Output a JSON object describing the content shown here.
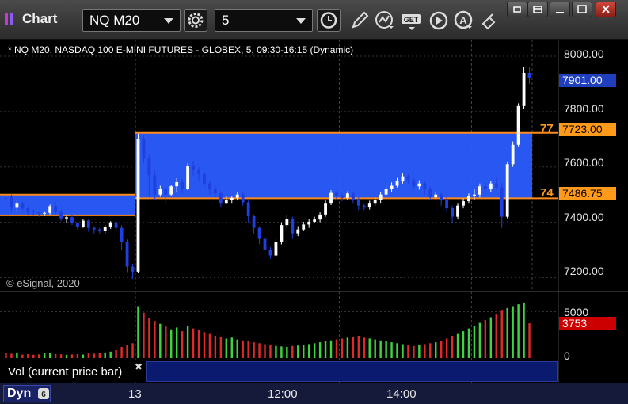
{
  "window": {
    "title": "Chart",
    "symbol": "NQ M20",
    "interval": "5"
  },
  "chart": {
    "header": "* NQ M20, NASDAQ 100 E-MINI FUTURES - GLOBEX, 5, 09:30-16:15 (Dynamic)",
    "copyright": "© eSignal, 2020",
    "y_axis_labels": [
      "8000.00",
      "7800.00",
      "7600.00",
      "7400.00",
      "7200.00"
    ],
    "current_price": "7901.00",
    "level_high": "7723.00",
    "level_low": "7486.75",
    "level_high_tag": "77",
    "level_low_tag": "74",
    "colors": {
      "zone": "#2a5cff",
      "level_line": "#ff8c1a",
      "current_flag": "#1f3fbf",
      "level_flag": "#ff9a1a",
      "vol_flag": "#cc0000",
      "up_candle": "#ffffff",
      "down_candle": "#1f3fe0",
      "vol_up": "#3fd43f",
      "vol_down": "#e02a2a"
    }
  },
  "volume": {
    "label": "Vol (current price bar)",
    "y_axis_labels": [
      "5000",
      "0"
    ],
    "current_value": "3753"
  },
  "bottom": {
    "mode": "Dyn",
    "time_labels": [
      "13",
      "12:00",
      "14:00"
    ]
  },
  "chart_data": {
    "type": "candlestick",
    "title": "* NQ M20, NASDAQ 100 E-MINI FUTURES - GLOBEX, 5, 09:30-16:15 (Dynamic)",
    "ylim": [
      7150,
      8060
    ],
    "zones": [
      {
        "x_from": 0,
        "x_to": 23,
        "high": 7500,
        "low": 7425
      },
      {
        "x_from": 24,
        "x_to": 95,
        "high": 7723,
        "low": 7486.75
      }
    ],
    "candles": [
      [
        7488,
        7485,
        7480,
        7492
      ],
      [
        7492,
        7455,
        7440,
        7500
      ],
      [
        7455,
        7470,
        7440,
        7478
      ],
      [
        7470,
        7450,
        7444,
        7474
      ],
      [
        7450,
        7440,
        7428,
        7456
      ],
      [
        7440,
        7436,
        7424,
        7446
      ],
      [
        7436,
        7432,
        7420,
        7440
      ],
      [
        7432,
        7434,
        7422,
        7440
      ],
      [
        7434,
        7458,
        7428,
        7464
      ],
      [
        7458,
        7440,
        7430,
        7472
      ],
      [
        7440,
        7414,
        7404,
        7446
      ],
      [
        7414,
        7418,
        7398,
        7424
      ],
      [
        7418,
        7396,
        7390,
        7426
      ],
      [
        7396,
        7384,
        7374,
        7400
      ],
      [
        7384,
        7406,
        7380,
        7412
      ],
      [
        7406,
        7380,
        7366,
        7410
      ],
      [
        7380,
        7374,
        7360,
        7386
      ],
      [
        7374,
        7368,
        7360,
        7380
      ],
      [
        7368,
        7384,
        7360,
        7390
      ],
      [
        7384,
        7400,
        7376,
        7404
      ],
      [
        7400,
        7380,
        7370,
        7410
      ],
      [
        7380,
        7330,
        7300,
        7390
      ],
      [
        7330,
        7240,
        7220,
        7338
      ],
      [
        7240,
        7222,
        7196,
        7250
      ],
      [
        7222,
        7702,
        7216,
        7720
      ],
      [
        7702,
        7630,
        7614,
        7712
      ],
      [
        7630,
        7570,
        7490,
        7642
      ],
      [
        7570,
        7500,
        7480,
        7590
      ],
      [
        7500,
        7520,
        7492,
        7532
      ],
      [
        7520,
        7500,
        7470,
        7526
      ],
      [
        7500,
        7530,
        7494,
        7536
      ],
      [
        7530,
        7545,
        7510,
        7560
      ],
      [
        7545,
        7520,
        7504,
        7556
      ],
      [
        7520,
        7602,
        7516,
        7614
      ],
      [
        7602,
        7590,
        7570,
        7622
      ],
      [
        7590,
        7574,
        7548,
        7600
      ],
      [
        7574,
        7540,
        7520,
        7580
      ],
      [
        7540,
        7522,
        7500,
        7546
      ],
      [
        7522,
        7504,
        7490,
        7530
      ],
      [
        7504,
        7470,
        7456,
        7512
      ],
      [
        7470,
        7480,
        7466,
        7496
      ],
      [
        7480,
        7488,
        7470,
        7494
      ],
      [
        7488,
        7500,
        7480,
        7510
      ],
      [
        7500,
        7472,
        7460,
        7508
      ],
      [
        7472,
        7422,
        7400,
        7478
      ],
      [
        7422,
        7380,
        7360,
        7428
      ],
      [
        7380,
        7340,
        7322,
        7386
      ],
      [
        7340,
        7302,
        7280,
        7348
      ],
      [
        7302,
        7280,
        7268,
        7310
      ],
      [
        7280,
        7330,
        7270,
        7340
      ],
      [
        7330,
        7390,
        7320,
        7400
      ],
      [
        7390,
        7412,
        7380,
        7426
      ],
      [
        7412,
        7360,
        7340,
        7420
      ],
      [
        7360,
        7374,
        7350,
        7386
      ],
      [
        7374,
        7392,
        7370,
        7402
      ],
      [
        7392,
        7402,
        7380,
        7412
      ],
      [
        7402,
        7410,
        7396,
        7420
      ],
      [
        7410,
        7428,
        7400,
        7436
      ],
      [
        7428,
        7470,
        7420,
        7480
      ],
      [
        7470,
        7506,
        7462,
        7516
      ],
      [
        7506,
        7496,
        7484,
        7514
      ],
      [
        7496,
        7488,
        7476,
        7504
      ],
      [
        7488,
        7504,
        7480,
        7512
      ],
      [
        7504,
        7482,
        7470,
        7510
      ],
      [
        7482,
        7460,
        7444,
        7490
      ],
      [
        7460,
        7456,
        7444,
        7468
      ],
      [
        7456,
        7470,
        7446,
        7478
      ],
      [
        7470,
        7480,
        7460,
        7490
      ],
      [
        7480,
        7500,
        7470,
        7510
      ],
      [
        7500,
        7520,
        7494,
        7532
      ],
      [
        7520,
        7532,
        7510,
        7544
      ],
      [
        7532,
        7550,
        7526,
        7560
      ],
      [
        7550,
        7566,
        7540,
        7576
      ],
      [
        7566,
        7552,
        7540,
        7574
      ],
      [
        7552,
        7530,
        7520,
        7560
      ],
      [
        7530,
        7540,
        7518,
        7552
      ],
      [
        7540,
        7520,
        7500,
        7548
      ],
      [
        7520,
        7490,
        7480,
        7530
      ],
      [
        7490,
        7500,
        7486,
        7510
      ],
      [
        7500,
        7480,
        7460,
        7506
      ],
      [
        7480,
        7452,
        7440,
        7490
      ],
      [
        7452,
        7420,
        7396,
        7460
      ],
      [
        7420,
        7460,
        7410,
        7470
      ],
      [
        7460,
        7476,
        7450,
        7486
      ],
      [
        7476,
        7496,
        7470,
        7504
      ],
      [
        7496,
        7500,
        7482,
        7520
      ],
      [
        7500,
        7530,
        7490,
        7540
      ],
      [
        7530,
        7520,
        7500,
        7540
      ],
      [
        7520,
        7540,
        7510,
        7550
      ],
      [
        7540,
        7526,
        7516,
        7560
      ],
      [
        7526,
        7420,
        7380,
        7540
      ],
      [
        7420,
        7610,
        7414,
        7620
      ],
      [
        7610,
        7680,
        7600,
        7692
      ],
      [
        7680,
        7820,
        7674,
        7830
      ],
      [
        7820,
        7940,
        7810,
        7960
      ],
      [
        7940,
        7920,
        7900,
        7962
      ]
    ],
    "volume": [
      520,
      480,
      610,
      380,
      420,
      360,
      400,
      520,
      580,
      440,
      410,
      350,
      390,
      430,
      380,
      520,
      480,
      560,
      610,
      700,
      860,
      1200,
      1400,
      1600,
      5600,
      4900,
      4300,
      4000,
      3700,
      3400,
      3100,
      3300,
      2900,
      3500,
      3200,
      3000,
      2800,
      2600,
      2400,
      2300,
      2100,
      2200,
      2000,
      1900,
      1800,
      1700,
      1600,
      1500,
      1400,
      1300,
      1250,
      1200,
      1300,
      1350,
      1400,
      1500,
      1600,
      1700,
      1800,
      1900,
      2000,
      2100,
      2200,
      2300,
      2400,
      2200,
      2100,
      2000,
      1900,
      1800,
      1700,
      1600,
      1500,
      1400,
      1300,
      1400,
      1500,
      1600,
      1700,
      1800,
      2100,
      2400,
      2600,
      2900,
      3200,
      3500,
      3800,
      4100,
      4400,
      4700,
      5200,
      5400,
      5600,
      5800,
      6000,
      3753
    ],
    "volume_ylim": [
      0,
      6500
    ]
  }
}
